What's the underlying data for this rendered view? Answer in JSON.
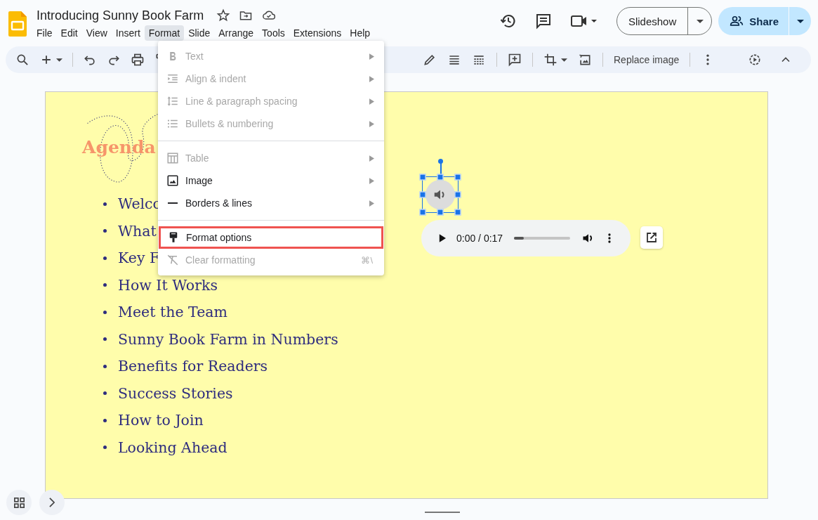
{
  "document": {
    "title": "Introducing Sunny Book Farm"
  },
  "menu_bar": [
    {
      "label": "File",
      "selected": false
    },
    {
      "label": "Edit",
      "selected": false
    },
    {
      "label": "View",
      "selected": false
    },
    {
      "label": "Insert",
      "selected": false
    },
    {
      "label": "Format",
      "selected": true
    },
    {
      "label": "Slide",
      "selected": false
    },
    {
      "label": "Arrange",
      "selected": false
    },
    {
      "label": "Tools",
      "selected": false
    },
    {
      "label": "Extensions",
      "selected": false
    },
    {
      "label": "Help",
      "selected": false
    }
  ],
  "header_buttons": {
    "slideshow": "Slideshow",
    "share": "Share"
  },
  "toolbar": {
    "replace_image": "Replace image"
  },
  "format_menu": [
    {
      "kind": "item",
      "label": "Text",
      "disabled": true,
      "submenu": true,
      "highlighted": false
    },
    {
      "kind": "item",
      "label": "Align & indent",
      "disabled": true,
      "submenu": true,
      "highlighted": false
    },
    {
      "kind": "item",
      "label": "Line & paragraph spacing",
      "disabled": true,
      "submenu": true,
      "highlighted": false
    },
    {
      "kind": "item",
      "label": "Bullets & numbering",
      "disabled": true,
      "submenu": true,
      "highlighted": false
    },
    {
      "kind": "separator"
    },
    {
      "kind": "item",
      "label": "Table",
      "disabled": true,
      "submenu": true,
      "highlighted": false
    },
    {
      "kind": "item",
      "label": "Image",
      "disabled": false,
      "submenu": true,
      "highlighted": false
    },
    {
      "kind": "item",
      "label": "Borders & lines",
      "disabled": false,
      "submenu": true,
      "highlighted": false
    },
    {
      "kind": "separator"
    },
    {
      "kind": "item",
      "label": "Format options",
      "disabled": false,
      "submenu": false,
      "highlighted": true
    },
    {
      "kind": "item",
      "label": "Clear formatting",
      "disabled": true,
      "submenu": false,
      "highlighted": false,
      "shortcut": "⌘\\"
    }
  ],
  "slide": {
    "title": "Agenda",
    "bullets": [
      "Welco",
      "What",
      "Key F",
      "How It Works",
      "Meet the Team",
      "Sunny Book Farm in Numbers",
      "Benefits for Readers",
      "Success Stories",
      "How to Join",
      "Looking Ahead"
    ]
  },
  "audio_player": {
    "time": "0:00 / 0:17",
    "level": 0.17
  }
}
